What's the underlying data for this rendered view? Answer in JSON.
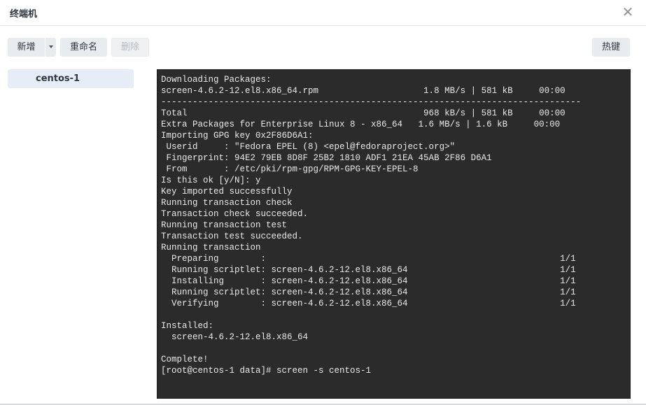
{
  "window": {
    "title": "终端机",
    "close_icon": "close-icon"
  },
  "toolbar": {
    "new_label": "新增",
    "rename_label": "重命名",
    "delete_label": "删除",
    "hotkey_label": "热键"
  },
  "sessions": [
    {
      "label": "centos-1"
    }
  ],
  "terminal": {
    "output": "Downloading Packages:\nscreen-4.6.2-12.el8.x86_64.rpm                    1.8 MB/s | 581 kB     00:00\n--------------------------------------------------------------------------------\nTotal                                             968 kB/s | 581 kB     00:00\nExtra Packages for Enterprise Linux 8 - x86_64   1.6 MB/s | 1.6 kB     00:00\nImporting GPG key 0x2F86D6A1:\n Userid     : \"Fedora EPEL (8) <epel@fedoraproject.org>\"\n Fingerprint: 94E2 79EB 8D8F 25B2 1810 ADF1 21EA 45AB 2F86 D6A1\n From       : /etc/pki/rpm-gpg/RPM-GPG-KEY-EPEL-8\nIs this ok [y/N]: y\nKey imported successfully\nRunning transaction check\nTransaction check succeeded.\nRunning transaction test\nTransaction test succeeded.\nRunning transaction\n  Preparing        :                                                        1/1\n  Running scriptlet: screen-4.6.2-12.el8.x86_64                             1/1\n  Installing       : screen-4.6.2-12.el8.x86_64                             1/1\n  Running scriptlet: screen-4.6.2-12.el8.x86_64                             1/1\n  Verifying        : screen-4.6.2-12.el8.x86_64                             1/1\n\nInstalled:\n  screen-4.6.2-12.el8.x86_64\n\nComplete!\n[root@centos-1 data]# screen -s centos-1"
  }
}
